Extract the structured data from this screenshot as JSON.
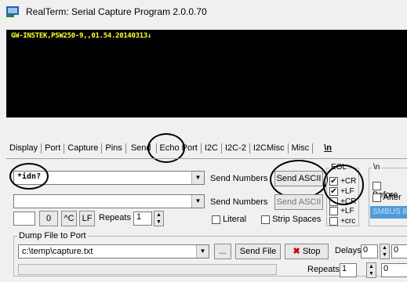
{
  "window": {
    "title": "RealTerm: Serial Capture Program 2.0.0.70"
  },
  "terminal": {
    "line": "GW-INSTEK,PSW250-9,,01.54.20140313↓"
  },
  "tabs": [
    "Display",
    "Port",
    "Capture",
    "Pins",
    "Send",
    "Echo Port",
    "I2C",
    "I2C-2",
    "I2CMisc",
    "Misc",
    "\\n"
  ],
  "active_tab": "Send",
  "send": {
    "line1_value": "*idn?",
    "line2_value": "",
    "send_numbers_1": "Send Numbers",
    "send_numbers_2": "Send Numbers",
    "send_ascii_1": "Send ASCII",
    "send_ascii_2": "Send ASCII",
    "small_value": "",
    "zero_button": "0",
    "ctrl_c_button": "^C",
    "lf_button": "LF",
    "repeats_label": "Repeats",
    "repeats_value": "1",
    "literal_label": "Literal",
    "strip_spaces_label": "Strip Spaces",
    "eol_label": "EOL",
    "eol_cr_1": "+CR",
    "eol_lf_1": "+LF",
    "eol_cr_2": "+CR",
    "eol_lf_2": "+LF",
    "eol_crc": "+crc",
    "eol_cr_1_checked": true,
    "eol_lf_1_checked": true,
    "n_group_label": "\\n",
    "before_label": "Before",
    "after_label": "After",
    "smbus_label": "SMBUS 8"
  },
  "dump": {
    "group_label": "Dump File to Port",
    "file_path": "c:\\temp\\capture.txt",
    "browse_button": "...",
    "send_file_button": "Send File",
    "stop_button": "Stop",
    "delays_label": "Delays",
    "delays_value_1": "0",
    "delays_value_2": "0",
    "repeats_label": "Repeats",
    "repeats_value": "1",
    "repeats_value_2": "0"
  }
}
